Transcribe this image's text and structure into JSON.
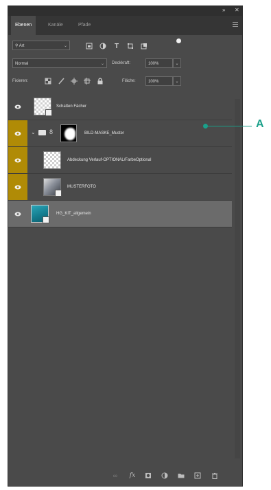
{
  "tabs": [
    {
      "label": "Ebenen",
      "active": true
    },
    {
      "label": "Kanäle",
      "active": false
    },
    {
      "label": "Pfade",
      "active": false
    }
  ],
  "filter": {
    "kind_label": "Art",
    "icons": [
      "pixel-filter-icon",
      "adjustment-filter-icon",
      "type-filter-icon",
      "shape-filter-icon",
      "smart-object-filter-icon"
    ]
  },
  "blend": {
    "mode": "Normal",
    "opacity_label": "Deckkraft:",
    "opacity_value": "100%"
  },
  "lock": {
    "label": "Fixieren:",
    "fill_label": "Fläche:",
    "fill_value": "100%"
  },
  "layers": [
    {
      "name": "Schatten Fächer",
      "visible_highlight": false,
      "selected": false
    },
    {
      "name": "BILD-MASKE_Muster",
      "visible_highlight": true,
      "selected": false
    },
    {
      "name": "Abdeckung Verlauf-OPTIONAL/FarbeOptional",
      "visible_highlight": true,
      "selected": false
    },
    {
      "name": "MUSTERFOTO",
      "visible_highlight": true,
      "selected": false
    },
    {
      "name": "HG_KIT_allgemein",
      "visible_highlight": false,
      "selected": true
    }
  ],
  "callout": {
    "label": "A",
    "color": "#1aa08a"
  },
  "colors": {
    "panel": "#4a4a4a",
    "tabbar": "#353535",
    "eye_highlight": "#b08b06",
    "selected_row": "#6b6b6b"
  }
}
